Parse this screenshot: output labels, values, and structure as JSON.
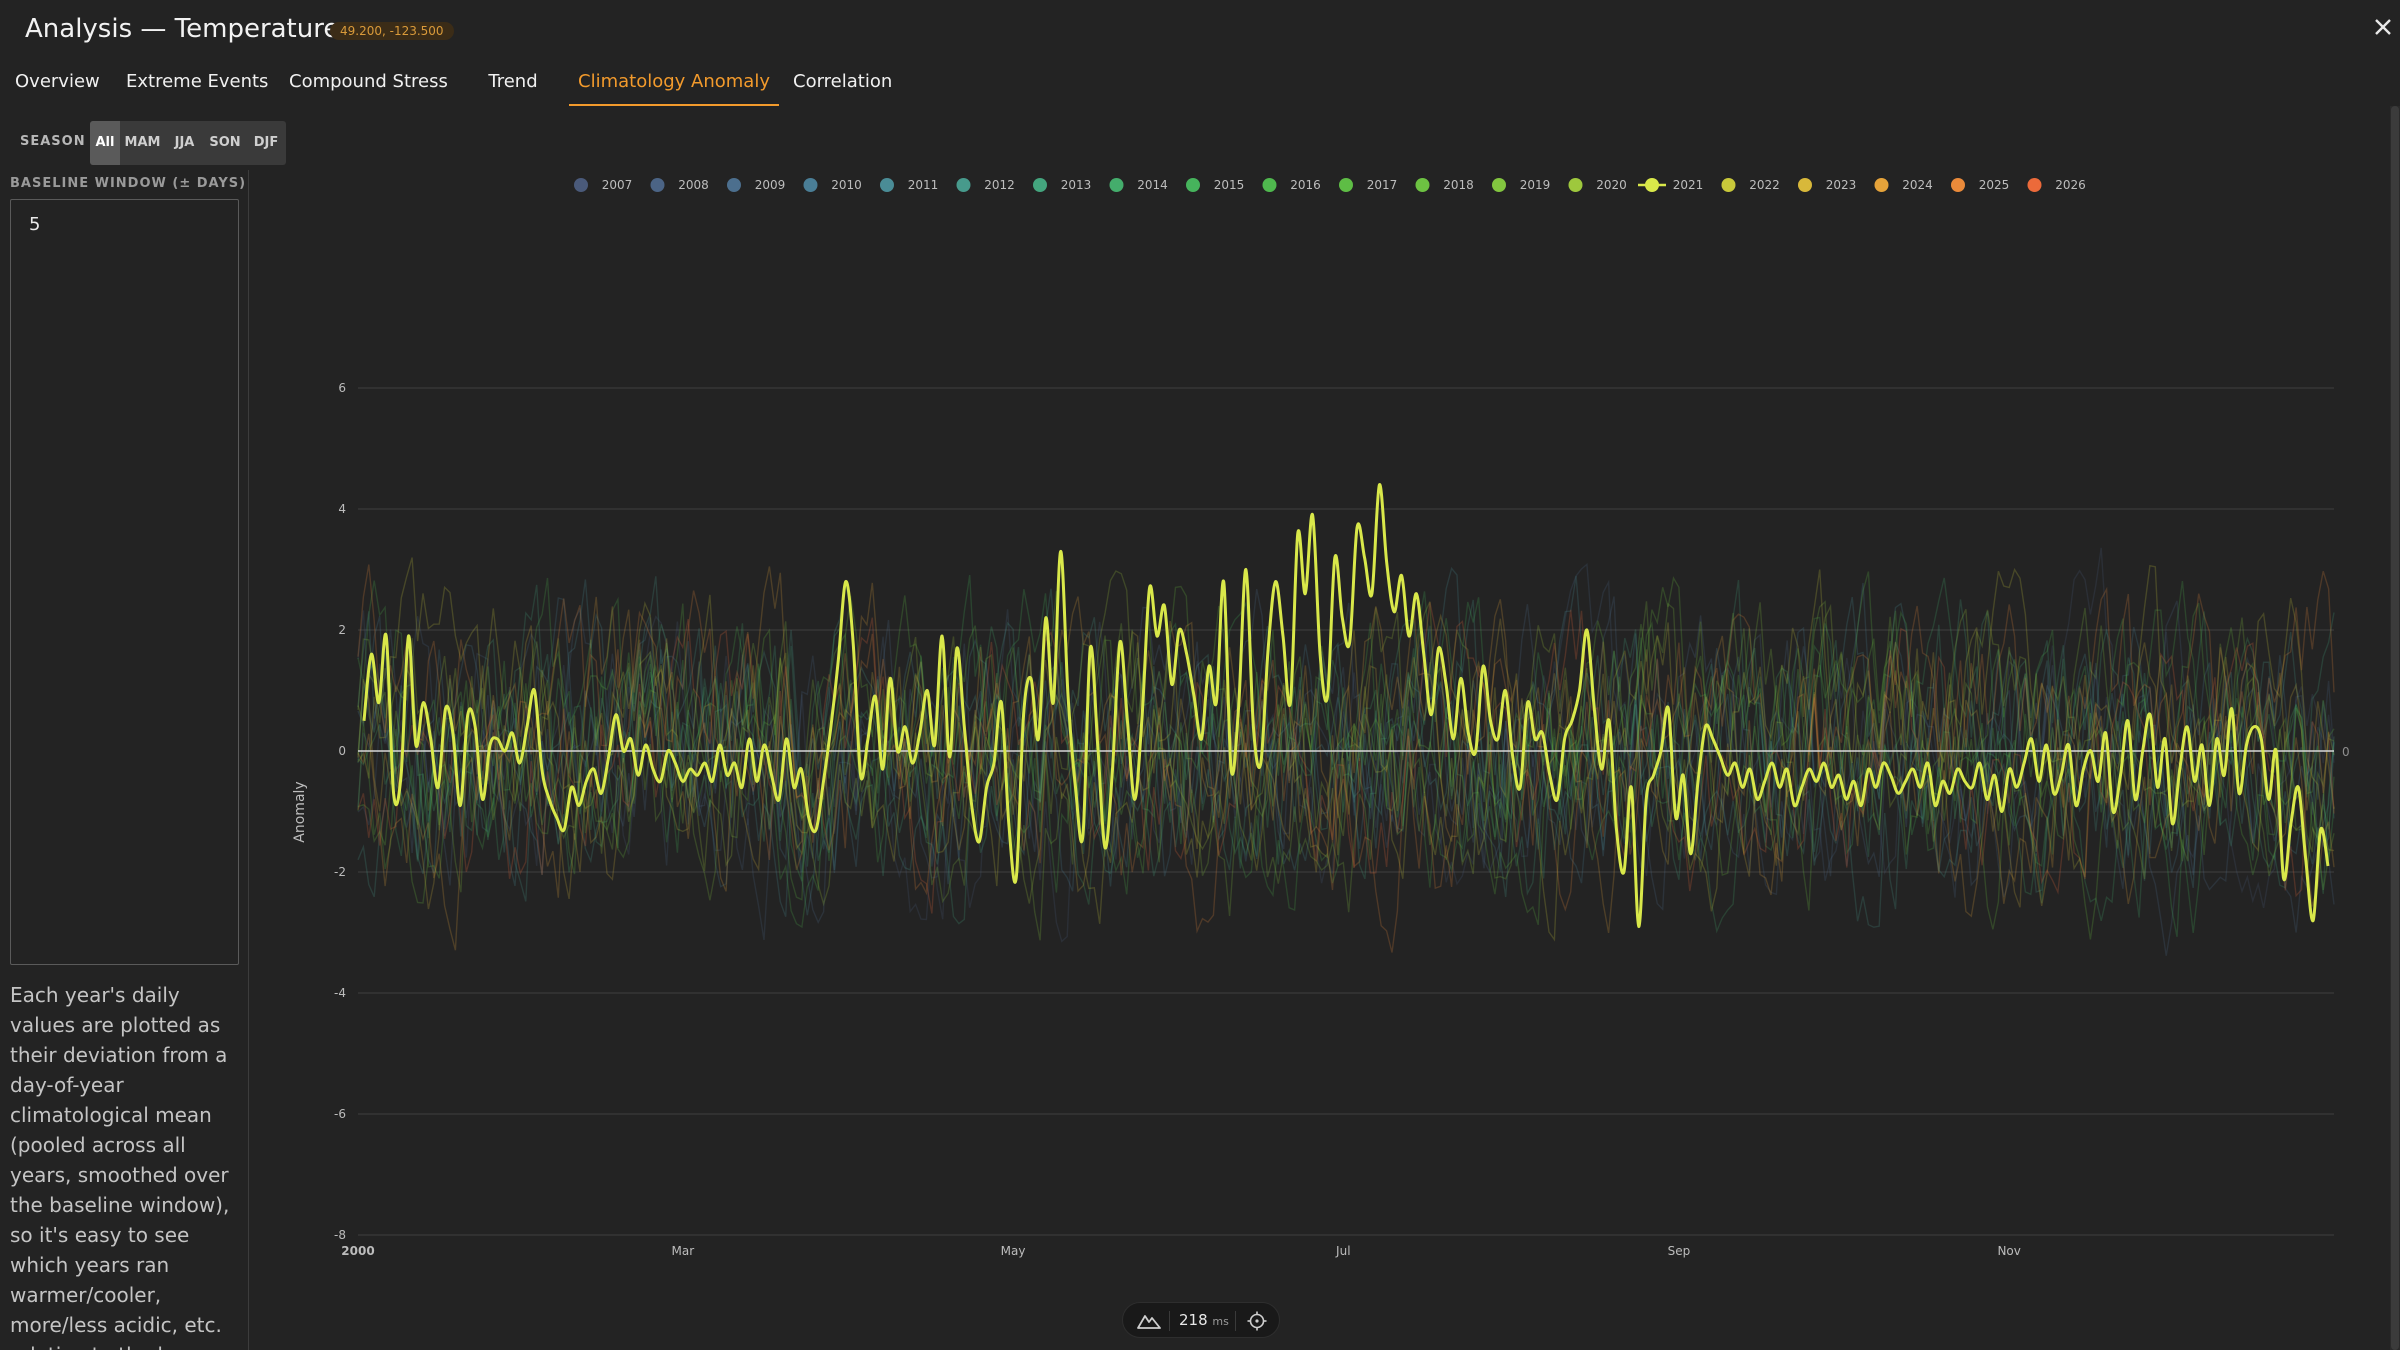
{
  "header": {
    "title": "Analysis — Temperature",
    "coordinates": "49.200, -123.500",
    "close_icon": "close-icon"
  },
  "tabs": [
    {
      "label": "Overview",
      "active": false
    },
    {
      "label": "Extreme Events",
      "active": false
    },
    {
      "label": "Compound Stress",
      "active": false
    },
    {
      "label": "Trend",
      "active": false
    },
    {
      "label": "Climatology Anomaly",
      "active": true
    },
    {
      "label": "Correlation",
      "active": false
    }
  ],
  "season": {
    "label": "SEASON",
    "options": [
      "All",
      "MAM",
      "JJA",
      "SON",
      "DJF"
    ],
    "selected": "All"
  },
  "baseline": {
    "label": "BASELINE WINDOW (± DAYS)",
    "value": "5"
  },
  "description": "Each year's daily values are plotted as their deviation from a day-of-year climatological mean (pooled across all years, smoothed over the baseline window), so it's easy to see which years ran warmer/cooler, more/less acidic, etc. relative to the long-term",
  "status": {
    "ms": "218",
    "unit": "ms",
    "icons": [
      "mountain-icon",
      "crosshair-icon"
    ]
  },
  "colors": {
    "accent": "#f29a2c",
    "highlight_series": "#d9e84a",
    "zero_line": "#d8d8d8"
  },
  "chart_data": {
    "type": "line",
    "ylabel": "Anomaly",
    "ylim": [
      -8,
      6
    ],
    "yticks": [
      6,
      4,
      2,
      0,
      -2,
      -4,
      -6,
      -8
    ],
    "x_axis": "day-of-year",
    "x_tick_labels": [
      "2000",
      "Mar",
      "May",
      "Jul",
      "Sep",
      "Nov"
    ],
    "x_tick_days": [
      1,
      61,
      122,
      183,
      245,
      306
    ],
    "zero_right_label": "0",
    "legend_position": "top",
    "highlighted_series": "2021",
    "series": [
      {
        "name": "2007",
        "color": "#4a5a7a"
      },
      {
        "name": "2008",
        "color": "#4b6485"
      },
      {
        "name": "2009",
        "color": "#4c6f8e"
      },
      {
        "name": "2010",
        "color": "#4a7e96"
      },
      {
        "name": "2011",
        "color": "#4a8c96"
      },
      {
        "name": "2012",
        "color": "#479a8c"
      },
      {
        "name": "2013",
        "color": "#44a57e"
      },
      {
        "name": "2014",
        "color": "#44ad6c"
      },
      {
        "name": "2015",
        "color": "#46b45c"
      },
      {
        "name": "2016",
        "color": "#4fb84e"
      },
      {
        "name": "2017",
        "color": "#5ebd45"
      },
      {
        "name": "2018",
        "color": "#6dc242"
      },
      {
        "name": "2019",
        "color": "#82c53f"
      },
      {
        "name": "2020",
        "color": "#9ec83d"
      },
      {
        "name": "2021",
        "color": "#d9e84a",
        "values": [
          0.5,
          1.6,
          0.8,
          1.9,
          -0.7,
          -0.4,
          1.9,
          0.1,
          0.8,
          0.2,
          -0.6,
          0.7,
          0.3,
          -0.9,
          0.6,
          0.4,
          -0.8,
          0.1,
          0.2,
          0.0,
          0.3,
          -0.2,
          0.4,
          1.0,
          -0.3,
          -0.8,
          -1.1,
          -1.3,
          -0.6,
          -0.9,
          -0.5,
          -0.3,
          -0.7,
          -0.1,
          0.6,
          0.0,
          0.2,
          -0.4,
          0.1,
          -0.3,
          -0.5,
          0.0,
          -0.2,
          -0.5,
          -0.3,
          -0.4,
          -0.2,
          -0.5,
          0.1,
          -0.4,
          -0.2,
          -0.6,
          0.2,
          -0.5,
          0.1,
          -0.4,
          -0.8,
          0.2,
          -0.6,
          -0.3,
          -1.1,
          -1.3,
          -0.5,
          0.4,
          1.5,
          2.8,
          1.8,
          -0.4,
          0.2,
          0.9,
          -0.3,
          1.2,
          0.0,
          0.4,
          -0.2,
          0.3,
          1.0,
          0.1,
          1.9,
          -0.1,
          1.7,
          0.4,
          -0.9,
          -1.5,
          -0.6,
          -0.2,
          0.8,
          -1.2,
          -2.1,
          0.6,
          1.2,
          0.2,
          2.2,
          0.8,
          3.3,
          0.9,
          -0.6,
          -1.4,
          1.7,
          0.1,
          -1.6,
          -0.3,
          1.8,
          0.5,
          -0.8,
          0.6,
          2.7,
          1.9,
          2.4,
          1.1,
          2.0,
          1.6,
          0.9,
          0.2,
          1.4,
          0.8,
          2.8,
          -0.3,
          0.7,
          3.0,
          0.4,
          -0.2,
          1.7,
          2.8,
          1.9,
          0.8,
          3.6,
          2.6,
          3.9,
          1.6,
          0.9,
          3.2,
          2.2,
          1.8,
          3.7,
          3.2,
          2.6,
          4.4,
          3.1,
          2.3,
          2.9,
          1.9,
          2.6,
          1.6,
          0.6,
          1.7,
          1.1,
          0.2,
          1.2,
          0.3,
          0.0,
          1.4,
          0.5,
          0.2,
          1.0,
          -0.1,
          -0.6,
          0.8,
          0.2,
          0.3,
          -0.4,
          -0.8,
          0.2,
          0.5,
          1.0,
          2.0,
          0.7,
          -0.3,
          0.5,
          -1.3,
          -2.0,
          -0.6,
          -2.9,
          -0.8,
          -0.4,
          0.0,
          0.7,
          -1.1,
          -0.4,
          -1.7,
          -0.5,
          0.4,
          0.2,
          -0.1,
          -0.4,
          -0.2,
          -0.6,
          -0.3,
          -0.8,
          -0.5,
          -0.2,
          -0.6,
          -0.3,
          -0.9,
          -0.6,
          -0.3,
          -0.5,
          -0.2,
          -0.6,
          -0.4,
          -0.8,
          -0.5,
          -0.9,
          -0.3,
          -0.6,
          -0.2,
          -0.4,
          -0.7,
          -0.5,
          -0.3,
          -0.6,
          -0.2,
          -0.9,
          -0.5,
          -0.7,
          -0.3,
          -0.5,
          -0.6,
          -0.2,
          -0.8,
          -0.4,
          -1.0,
          -0.3,
          -0.6,
          -0.2,
          0.2,
          -0.5,
          0.1,
          -0.7,
          -0.4,
          0.1,
          -0.9,
          -0.3,
          0.0,
          -0.5,
          0.3,
          -1.0,
          -0.4,
          0.5,
          -0.8,
          0.0,
          0.6,
          -0.6,
          0.2,
          -1.2,
          -0.3,
          0.4,
          -0.5,
          0.1,
          -0.9,
          0.2,
          -0.4,
          0.7,
          -0.7,
          0.1,
          0.4,
          0.2,
          -0.8,
          0.0,
          -2.1,
          -1.2,
          -0.6,
          -1.8,
          -2.8,
          -1.3,
          -1.9
        ]
      },
      {
        "name": "2022",
        "color": "#c8c83a"
      },
      {
        "name": "2023",
        "color": "#d8b83a"
      },
      {
        "name": "2024",
        "color": "#e5a33a"
      },
      {
        "name": "2025",
        "color": "#ea8a3a"
      },
      {
        "name": "2026",
        "color": "#ec6a3a"
      }
    ]
  }
}
